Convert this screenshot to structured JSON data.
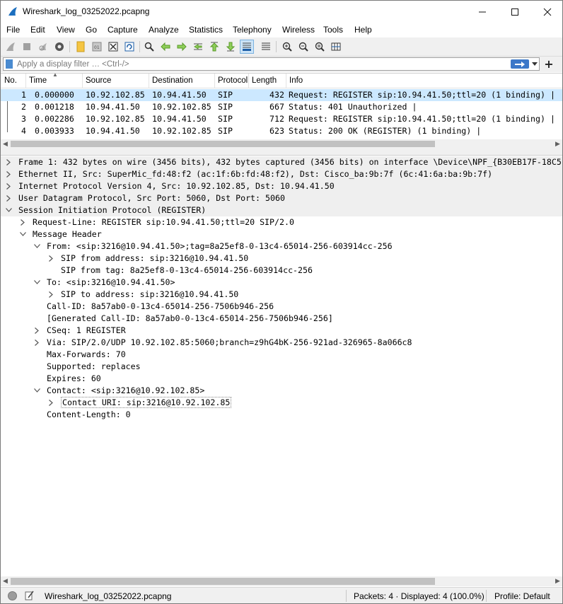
{
  "window": {
    "title": "Wireshark_log_03252022.pcapng",
    "icons": {
      "app": "shark-fin-icon",
      "minimize": "minimize-icon",
      "maximize": "maximize-icon",
      "close": "close-icon"
    }
  },
  "menu": [
    {
      "label": "File"
    },
    {
      "label": "Edit"
    },
    {
      "label": "View"
    },
    {
      "label": "Go"
    },
    {
      "label": "Capture"
    },
    {
      "label": "Analyze"
    },
    {
      "label": "Statistics"
    },
    {
      "label": "Telephony"
    },
    {
      "label": "Wireless"
    },
    {
      "label": "Tools"
    },
    {
      "label": "Help"
    }
  ],
  "toolbar": {
    "buttons": [
      "start-capture-icon",
      "stop-capture-icon",
      "restart-capture-icon",
      "capture-options-icon",
      "open-file-icon",
      "save-file-icon",
      "close-file-icon",
      "reload-file-icon",
      "find-packet-icon",
      "go-back-icon",
      "go-forward-icon",
      "go-to-packet-icon",
      "go-first-packet-icon",
      "go-last-packet-icon",
      "auto-scroll-icon",
      "colorize-icon",
      "zoom-in-icon",
      "zoom-out-icon",
      "zoom-normal-icon",
      "resize-columns-icon"
    ],
    "active": "auto-scroll-icon"
  },
  "filter": {
    "placeholder": "Apply a display filter … <Ctrl-/>",
    "value": "",
    "apply_icon": "apply-filter-arrow-icon",
    "bookmark_icon": "filter-bookmark-icon",
    "dropdown_icon": "chevron-down-icon",
    "add_label": "+"
  },
  "packet_list": {
    "columns": [
      "No.",
      "Time",
      "Source",
      "Destination",
      "Protocol",
      "Length",
      "Info"
    ],
    "rows": [
      {
        "no": "1",
        "time": "0.000000",
        "source": "10.92.102.85",
        "destination": "10.94.41.50",
        "protocol": "SIP",
        "length": "432",
        "info": "Request: REGISTER sip:10.94.41.50;ttl=20  (1 binding) |",
        "selected": true
      },
      {
        "no": "2",
        "time": "0.001218",
        "source": "10.94.41.50",
        "destination": "10.92.102.85",
        "protocol": "SIP",
        "length": "667",
        "info": "Status: 401 Unauthorized |",
        "selected": false
      },
      {
        "no": "3",
        "time": "0.002286",
        "source": "10.92.102.85",
        "destination": "10.94.41.50",
        "protocol": "SIP",
        "length": "712",
        "info": "Request: REGISTER sip:10.94.41.50;ttl=20  (1 binding) |",
        "selected": false
      },
      {
        "no": "4",
        "time": "0.003933",
        "source": "10.94.41.50",
        "destination": "10.92.102.85",
        "protocol": "SIP",
        "length": "623",
        "info": "Status: 200 OK (REGISTER)  (1 binding) |",
        "selected": false
      }
    ]
  },
  "detail_tree": [
    {
      "depth": 0,
      "toggle": "collapsed",
      "text": "Frame 1: 432 bytes on wire (3456 bits), 432 bytes captured (3456 bits) on interface \\Device\\NPF_{B30EB17F-18C5",
      "shade": true
    },
    {
      "depth": 0,
      "toggle": "collapsed",
      "text": "Ethernet II, Src: SuperMic_fd:48:f2 (ac:1f:6b:fd:48:f2), Dst: Cisco_ba:9b:7f (6c:41:6a:ba:9b:7f)",
      "shade": true
    },
    {
      "depth": 0,
      "toggle": "collapsed",
      "text": "Internet Protocol Version 4, Src: 10.92.102.85, Dst: 10.94.41.50",
      "shade": true
    },
    {
      "depth": 0,
      "toggle": "collapsed",
      "text": "User Datagram Protocol, Src Port: 5060, Dst Port: 5060",
      "shade": true
    },
    {
      "depth": 0,
      "toggle": "expanded",
      "text": "Session Initiation Protocol (REGISTER)",
      "shade": true
    },
    {
      "depth": 1,
      "toggle": "collapsed",
      "text": "Request-Line: REGISTER sip:10.94.41.50;ttl=20 SIP/2.0",
      "shade": false
    },
    {
      "depth": 1,
      "toggle": "expanded",
      "text": "Message Header",
      "shade": false
    },
    {
      "depth": 2,
      "toggle": "expanded",
      "text": "From: <sip:3216@10.94.41.50>;tag=8a25ef8-0-13c4-65014-256-603914cc-256",
      "shade": false
    },
    {
      "depth": 3,
      "toggle": "collapsed",
      "text": "SIP from address: sip:3216@10.94.41.50",
      "shade": false
    },
    {
      "depth": 3,
      "toggle": "none",
      "text": "SIP from tag: 8a25ef8-0-13c4-65014-256-603914cc-256",
      "shade": false
    },
    {
      "depth": 2,
      "toggle": "expanded",
      "text": "To: <sip:3216@10.94.41.50>",
      "shade": false
    },
    {
      "depth": 3,
      "toggle": "collapsed",
      "text": "SIP to address: sip:3216@10.94.41.50",
      "shade": false
    },
    {
      "depth": 2,
      "toggle": "none",
      "text": "Call-ID: 8a57ab0-0-13c4-65014-256-7506b946-256",
      "shade": false
    },
    {
      "depth": 2,
      "toggle": "none",
      "text": "[Generated Call-ID: 8a57ab0-0-13c4-65014-256-7506b946-256]",
      "shade": false
    },
    {
      "depth": 2,
      "toggle": "collapsed",
      "text": "CSeq: 1 REGISTER",
      "shade": false
    },
    {
      "depth": 2,
      "toggle": "collapsed",
      "text": "Via: SIP/2.0/UDP 10.92.102.85:5060;branch=z9hG4bK-256-921ad-326965-8a066c8",
      "shade": false
    },
    {
      "depth": 2,
      "toggle": "none",
      "text": "Max-Forwards: 70",
      "shade": false
    },
    {
      "depth": 2,
      "toggle": "none",
      "text": "Supported: replaces",
      "shade": false
    },
    {
      "depth": 2,
      "toggle": "none",
      "text": "Expires: 60",
      "shade": false
    },
    {
      "depth": 2,
      "toggle": "expanded",
      "text": "Contact: <sip:3216@10.92.102.85>",
      "shade": false
    },
    {
      "depth": 3,
      "toggle": "collapsed",
      "text": "Contact URI: sip:3216@10.92.102.85",
      "shade": false,
      "focused": true
    },
    {
      "depth": 2,
      "toggle": "none",
      "text": "Content-Length: 0",
      "shade": false
    }
  ],
  "status": {
    "file": "Wireshark_log_03252022.pcapng",
    "packets": "Packets: 4 · Displayed: 4 (100.0%)",
    "profile": "Profile: Default",
    "led_icon": "capture-status-led-icon",
    "edit_icon": "capture-comment-icon"
  }
}
